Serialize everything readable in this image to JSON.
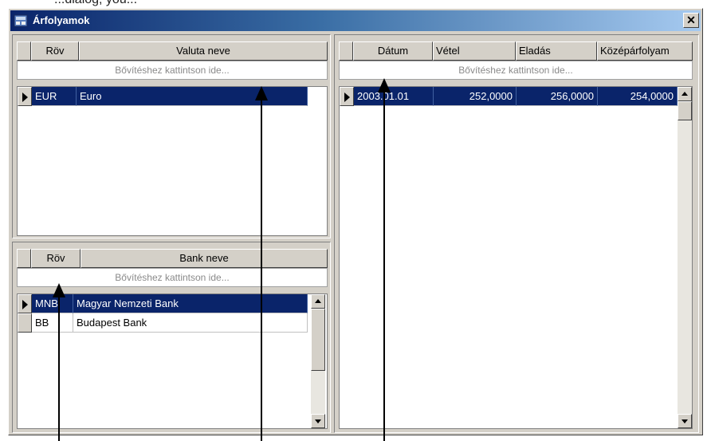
{
  "top_fragment": "...dialog, you...",
  "window": {
    "title": "Árfolyamok",
    "close_label": "✕"
  },
  "currency_panel": {
    "columns": [
      "Röv",
      "Valuta neve"
    ],
    "expand_text": "Bővítéshez kattintson ide...",
    "rows": [
      {
        "code": "EUR",
        "name": "Euro",
        "selected": true
      }
    ]
  },
  "bank_panel": {
    "columns": [
      "Röv",
      "Bank neve"
    ],
    "expand_text": "Bővítéshez kattintson ide...",
    "rows": [
      {
        "code": "MNB",
        "name": "Magyar Nemzeti Bank",
        "selected": true
      },
      {
        "code": "BB",
        "name": "Budapest Bank",
        "selected": false
      }
    ]
  },
  "rates_panel": {
    "columns": [
      "Dátum",
      "Vétel",
      "Eladás",
      "Középárfolyam"
    ],
    "expand_text": "Bővítéshez kattintson ide...",
    "rows": [
      {
        "date": "2003.01.01",
        "buy": "252,0000",
        "sell": "256,0000",
        "mid": "254,0000",
        "selected": true
      }
    ]
  }
}
